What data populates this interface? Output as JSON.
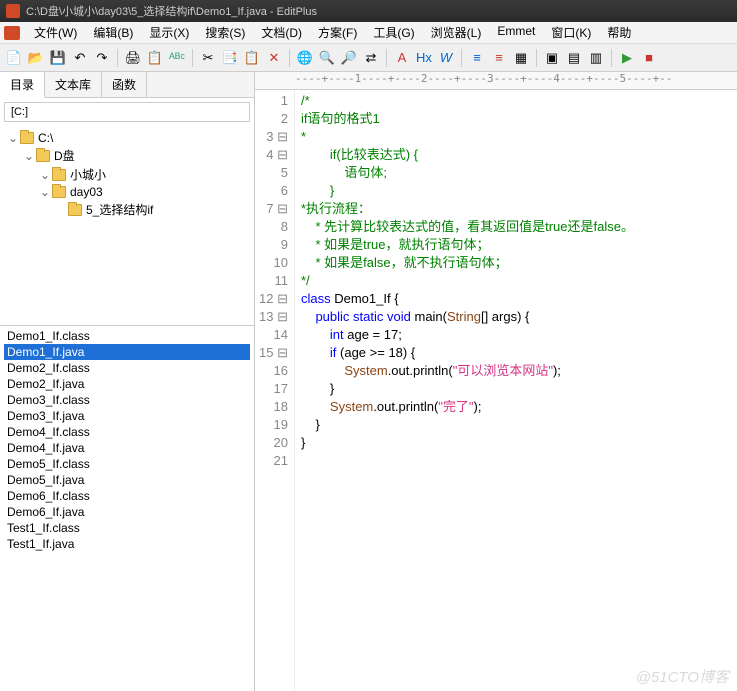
{
  "title": "C:\\D盘\\小城小\\day03\\5_选择结构if\\Demo1_If.java - EditPlus",
  "menu": [
    "文件(W)",
    "编辑(B)",
    "显示(X)",
    "搜索(S)",
    "文档(D)",
    "方案(F)",
    "工具(G)",
    "浏览器(L)",
    "Emmet",
    "窗口(K)",
    "帮助"
  ],
  "toolbar_icons": [
    {
      "n": "new-file-icon",
      "g": "📄"
    },
    {
      "n": "open-icon",
      "g": "📂"
    },
    {
      "n": "save-icon",
      "g": "💾"
    },
    {
      "n": "undo-icon",
      "g": "↶"
    },
    {
      "n": "redo-icon",
      "g": "↷"
    },
    {
      "sep": true
    },
    {
      "n": "print-icon",
      "g": "🖨"
    },
    {
      "n": "preview-icon",
      "g": "📋"
    },
    {
      "n": "spell-icon",
      "g": "ᴬᴮᶜ",
      "c": "#3a7"
    },
    {
      "sep": true
    },
    {
      "n": "cut-icon",
      "g": "✂"
    },
    {
      "n": "copy-icon",
      "g": "📑"
    },
    {
      "n": "paste-icon",
      "g": "📋"
    },
    {
      "n": "delete-icon",
      "g": "✕",
      "c": "#c33"
    },
    {
      "sep": true
    },
    {
      "n": "browser-icon",
      "g": "🌐"
    },
    {
      "n": "find-icon",
      "g": "🔍"
    },
    {
      "n": "find-next-icon",
      "g": "🔎"
    },
    {
      "n": "replace-icon",
      "g": "⇄"
    },
    {
      "sep": true
    },
    {
      "n": "font-icon",
      "g": "A",
      "c": "#c33"
    },
    {
      "n": "hex-icon",
      "g": "Hx",
      "c": "#06c"
    },
    {
      "n": "wrap-icon",
      "g": "W",
      "c": "#06c",
      "i": true
    },
    {
      "sep": true
    },
    {
      "n": "indent-icon",
      "g": "≡",
      "c": "#06c"
    },
    {
      "n": "outdent-icon",
      "g": "≡",
      "c": "#c33"
    },
    {
      "n": "columns-icon",
      "g": "▦"
    },
    {
      "sep": true
    },
    {
      "n": "bookmark-icon",
      "g": "▣"
    },
    {
      "n": "bookmark2-icon",
      "g": "▤"
    },
    {
      "n": "bookmark3-icon",
      "g": "▥"
    },
    {
      "sep": true
    },
    {
      "n": "run-icon",
      "g": "▶",
      "c": "#393"
    },
    {
      "n": "stop-icon",
      "g": "■",
      "c": "#c33"
    }
  ],
  "tabs": [
    {
      "label": "目录",
      "active": true
    },
    {
      "label": "文本库",
      "active": false
    },
    {
      "label": "函数",
      "active": false
    }
  ],
  "drive": "[C:]",
  "tree": [
    {
      "indent": 0,
      "tw": "⌄",
      "label": "C:\\"
    },
    {
      "indent": 1,
      "tw": "⌄",
      "label": "D盘"
    },
    {
      "indent": 2,
      "tw": "⌄",
      "label": "小城小"
    },
    {
      "indent": 2,
      "tw": "⌄",
      "label": "day03"
    },
    {
      "indent": 3,
      "tw": "",
      "label": "5_选择结构if",
      "sel": true
    }
  ],
  "files": [
    {
      "name": "Demo1_If.class"
    },
    {
      "name": "Demo1_If.java",
      "sel": true
    },
    {
      "name": "Demo2_If.class"
    },
    {
      "name": "Demo2_If.java"
    },
    {
      "name": "Demo3_If.class"
    },
    {
      "name": "Demo3_If.java"
    },
    {
      "name": "Demo4_If.class"
    },
    {
      "name": "Demo4_If.java"
    },
    {
      "name": "Demo5_If.class"
    },
    {
      "name": "Demo5_If.java"
    },
    {
      "name": "Demo6_If.class"
    },
    {
      "name": "Demo6_If.java"
    },
    {
      "name": "Test1_If.class"
    },
    {
      "name": "Test1_If.java"
    }
  ],
  "ruler": "----+----1----+----2----+----3----+----4----+----5----+--",
  "code": [
    {
      "n": 1,
      "f": "",
      "tokens": [
        {
          "t": "/*",
          "c": "c-green"
        }
      ]
    },
    {
      "n": 2,
      "f": "",
      "tokens": [
        {
          "t": "if语句的格式1",
          "c": "c-green"
        }
      ]
    },
    {
      "n": 3,
      "f": "⊟",
      "tokens": [
        {
          "t": "*",
          "c": "c-green"
        }
      ]
    },
    {
      "n": 4,
      "f": "⊟",
      "tokens": [
        {
          "t": "        if(比较表达式) {",
          "c": "c-green"
        }
      ]
    },
    {
      "n": 5,
      "f": "",
      "tokens": [
        {
          "t": "            语句体;",
          "c": "c-green"
        }
      ]
    },
    {
      "n": 6,
      "f": "",
      "tokens": [
        {
          "t": "        }",
          "c": "c-green"
        }
      ]
    },
    {
      "n": 7,
      "f": "⊟",
      "tokens": [
        {
          "t": "*执行流程：",
          "c": "c-green"
        }
      ]
    },
    {
      "n": 8,
      "f": "",
      "tokens": [
        {
          "t": "    * 先计算比较表达式的值，看其返回值是true还是false。",
          "c": "c-green"
        }
      ]
    },
    {
      "n": 9,
      "f": "",
      "tokens": [
        {
          "t": "    * 如果是true，就执行语句体；",
          "c": "c-green"
        }
      ]
    },
    {
      "n": 10,
      "f": "",
      "tokens": [
        {
          "t": "    * 如果是false，就不执行语句体；",
          "c": "c-green"
        }
      ]
    },
    {
      "n": 11,
      "f": "",
      "tokens": [
        {
          "t": "*/",
          "c": "c-green"
        }
      ]
    },
    {
      "n": 12,
      "f": "⊟",
      "tokens": [
        {
          "t": "class",
          "c": "c-blue"
        },
        {
          "t": " Demo1_If {",
          "c": "c-black"
        }
      ]
    },
    {
      "n": 13,
      "f": "⊟",
      "tokens": [
        {
          "t": "    ",
          "c": ""
        },
        {
          "t": "public",
          "c": "c-blue"
        },
        {
          "t": " ",
          "c": ""
        },
        {
          "t": "static",
          "c": "c-blue"
        },
        {
          "t": " ",
          "c": ""
        },
        {
          "t": "void",
          "c": "c-blue"
        },
        {
          "t": " main(",
          "c": "c-black"
        },
        {
          "t": "String",
          "c": "c-brown"
        },
        {
          "t": "[] args) {",
          "c": "c-black"
        }
      ]
    },
    {
      "n": 14,
      "f": "",
      "tokens": [
        {
          "t": "        ",
          "c": ""
        },
        {
          "t": "int",
          "c": "c-blue"
        },
        {
          "t": " age = 17;",
          "c": "c-black"
        }
      ]
    },
    {
      "n": 15,
      "f": "⊟",
      "tokens": [
        {
          "t": "        ",
          "c": ""
        },
        {
          "t": "if",
          "c": "c-blue"
        },
        {
          "t": " (age >= 18) {",
          "c": "c-black"
        }
      ]
    },
    {
      "n": 16,
      "f": "",
      "tokens": [
        {
          "t": "            ",
          "c": ""
        },
        {
          "t": "System",
          "c": "c-brown"
        },
        {
          "t": ".out.println(",
          "c": "c-black"
        },
        {
          "t": "\"可以浏览本网站\"",
          "c": "c-pink"
        },
        {
          "t": ");",
          "c": "c-black"
        }
      ]
    },
    {
      "n": 17,
      "f": "",
      "tokens": [
        {
          "t": "        }",
          "c": "c-black"
        }
      ]
    },
    {
      "n": 18,
      "f": "",
      "tokens": [
        {
          "t": "        ",
          "c": ""
        },
        {
          "t": "System",
          "c": "c-brown"
        },
        {
          "t": ".out.println(",
          "c": "c-black"
        },
        {
          "t": "\"完了\"",
          "c": "c-pink"
        },
        {
          "t": ");",
          "c": "c-black"
        }
      ]
    },
    {
      "n": 19,
      "f": "",
      "tokens": [
        {
          "t": "    }",
          "c": "c-black"
        }
      ]
    },
    {
      "n": 20,
      "f": "",
      "tokens": [
        {
          "t": "}",
          "c": "c-black"
        }
      ]
    },
    {
      "n": 21,
      "f": "",
      "tokens": [
        {
          "t": "",
          "c": ""
        }
      ]
    }
  ],
  "watermark": "@51CTO博客"
}
